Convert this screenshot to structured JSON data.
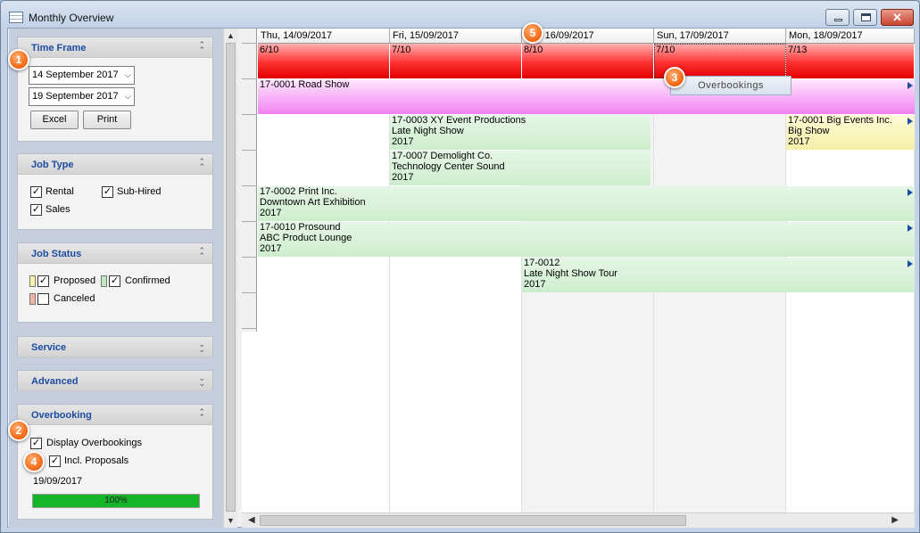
{
  "window": {
    "title": "Monthly Overview",
    "minimize_label": "minimize",
    "maximize_label": "maximize",
    "close_glyph": "✕"
  },
  "sidebar": {
    "time_frame": {
      "title": "Time Frame",
      "start_date": "14 September 2017",
      "end_date": "19 September 2017",
      "excel_label": "Excel",
      "print_label": "Print"
    },
    "job_type": {
      "title": "Job Type",
      "rental": {
        "label": "Rental",
        "checked": true
      },
      "sub_hired": {
        "label": "Sub-Hired",
        "checked": true
      },
      "sales": {
        "label": "Sales",
        "checked": true
      }
    },
    "job_status": {
      "title": "Job Status",
      "proposed": {
        "label": "Proposed",
        "checked": true,
        "color": "#f8f3a8"
      },
      "confirmed": {
        "label": "Confirmed",
        "checked": true,
        "color": "#bfe9bf"
      },
      "canceled": {
        "label": "Canceled",
        "checked": false,
        "color": "#f4b3a3"
      }
    },
    "service": {
      "title": "Service"
    },
    "advanced": {
      "title": "Advanced"
    },
    "overbooking": {
      "title": "Overbooking",
      "display_overbookings": {
        "label": "Display Overbookings",
        "checked": true
      },
      "incl_proposals": {
        "label": "Incl. Proposals",
        "checked": true
      },
      "date": "19/09/2017",
      "progress_percent": 100,
      "progress_label": "100%"
    }
  },
  "calendar": {
    "days": [
      {
        "label": "Thu, 14/09/2017",
        "ratio": "6/10"
      },
      {
        "label": "Fri, 15/09/2017",
        "ratio": "7/10"
      },
      {
        "label": "Sat, 16/09/2017",
        "ratio": "8/10"
      },
      {
        "label": "Sun, 17/09/2017",
        "ratio": "7/10"
      },
      {
        "label": "Mon, 18/09/2017",
        "ratio": "7/13"
      }
    ],
    "events": [
      {
        "lines": [
          "17-0001 Road Show"
        ],
        "color": "pink"
      },
      {
        "lines": [
          "17-0003 XY Event Productions",
          "Late Night Show",
          "2017"
        ],
        "color": "green"
      },
      {
        "lines": [
          "17-0001 Big Events Inc.",
          "Big Show",
          "2017"
        ],
        "color": "yellow"
      },
      {
        "lines": [
          "17-0007 Demolight Co.",
          "Technology Center Sound",
          "2017"
        ],
        "color": "green"
      },
      {
        "lines": [
          "17-0002 Print Inc.",
          "Downtown Art Exhibition",
          "2017"
        ],
        "color": "green"
      },
      {
        "lines": [
          "17-0010 Prosound",
          "ABC Product Lounge",
          "2017"
        ],
        "color": "green"
      },
      {
        "lines": [
          "17-0012",
          "Late Night Show Tour",
          "2017"
        ],
        "color": "green"
      }
    ],
    "overbookings_button": "Overbookings"
  },
  "markers": [
    "1",
    "2",
    "3",
    "4",
    "5"
  ]
}
